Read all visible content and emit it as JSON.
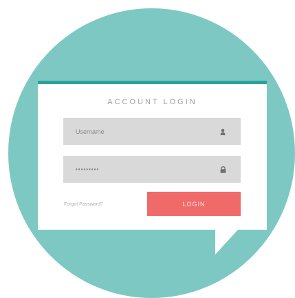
{
  "login": {
    "title": "ACCOUNT LOGIN",
    "username_placeholder": "Username",
    "password_mask": "•••••••••",
    "forgot_label": "Forgot Password?",
    "login_button_label": "LOGIN"
  },
  "icons": {
    "username_field_icon": "user-icon",
    "password_field_icon": "lock-icon"
  },
  "colors": {
    "circle_bg": "#7ec8c4",
    "card_accent": "#2aa39a",
    "input_bg": "#d9d9d9",
    "button_bg": "#f06a6a"
  }
}
